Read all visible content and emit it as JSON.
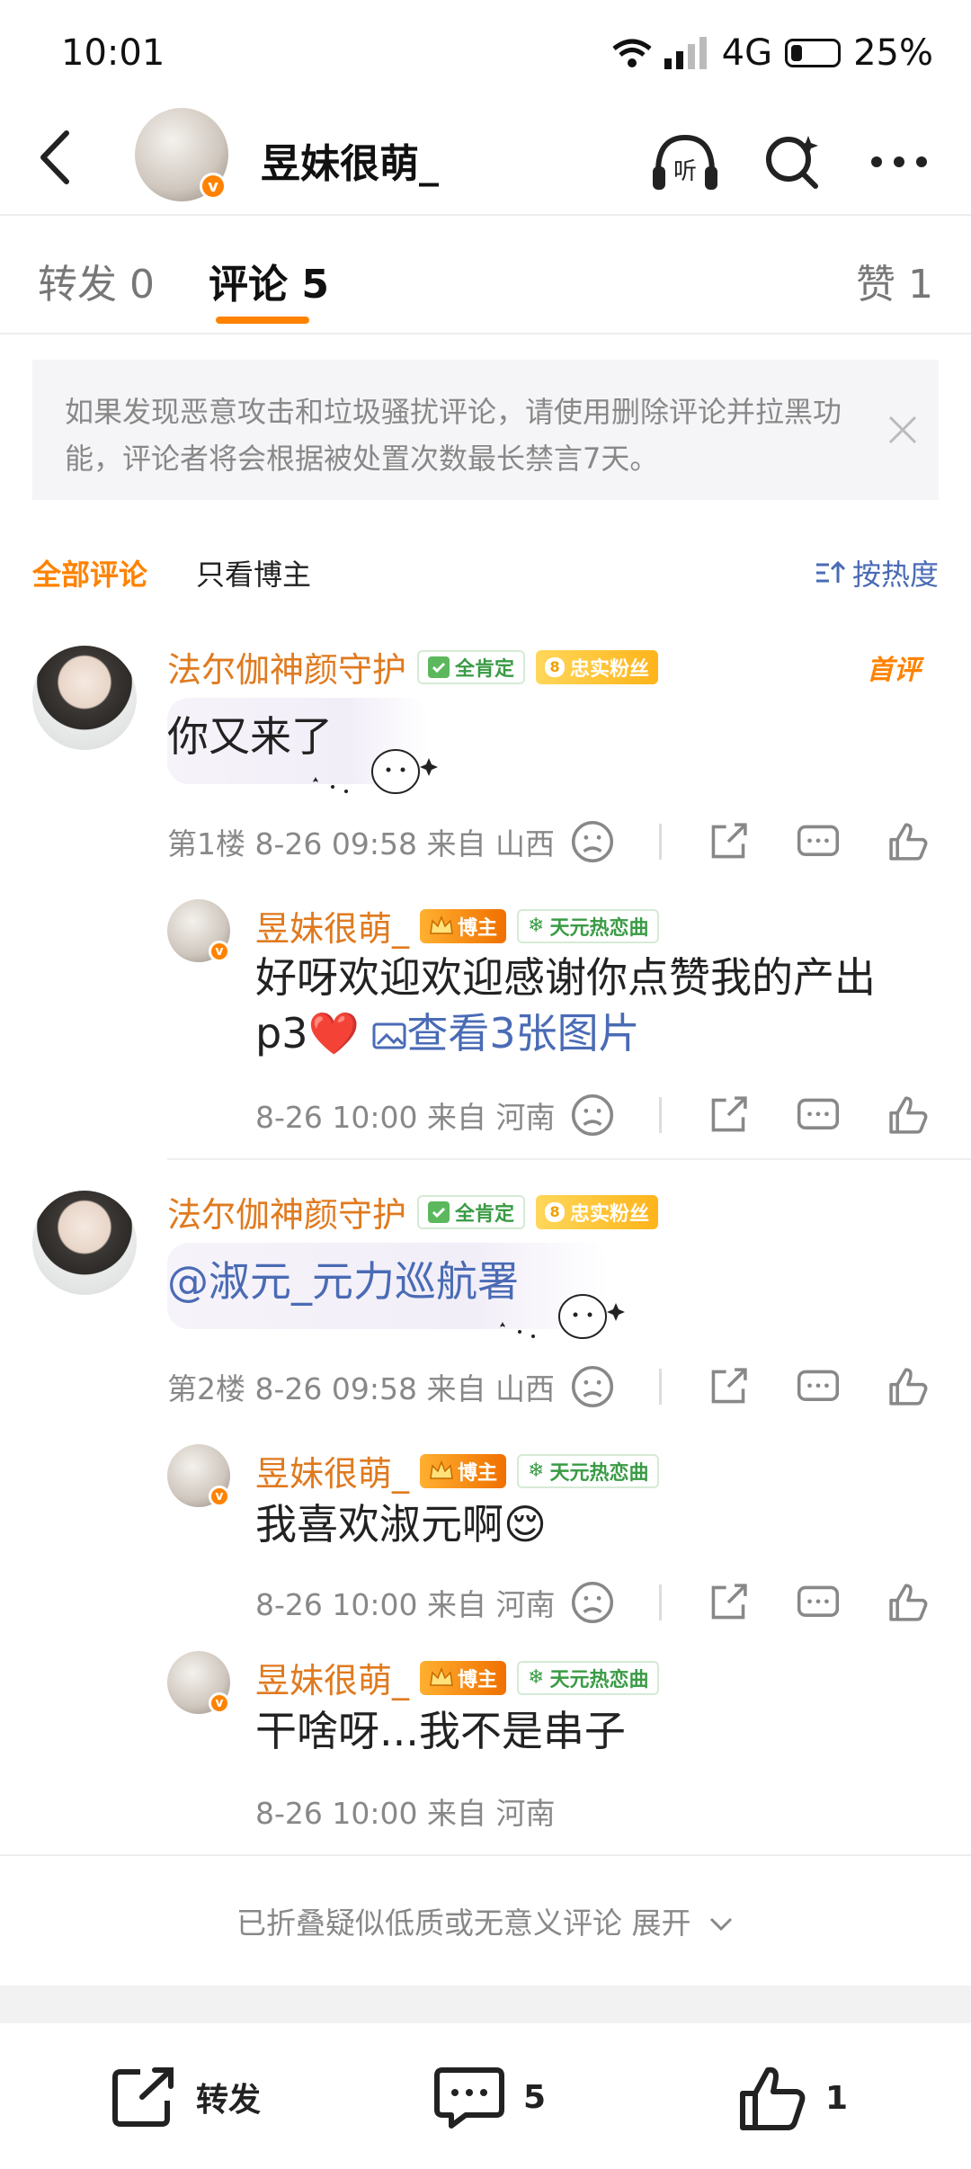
{
  "status": {
    "time": "10:01",
    "network": "4G",
    "battery": "25%",
    "battery_level": 0.25
  },
  "header": {
    "title": "昱妹很萌_",
    "verified_badge": "v"
  },
  "tabs": [
    {
      "label": "转发 0"
    },
    {
      "label": "评论 5"
    },
    {
      "label": "赞 1"
    }
  ],
  "notice": {
    "text": "如果发现恶意攻击和垃圾骚扰评论，请使用删除评论并拉黑功能，评论者将会根据被处置次数最长禁言7天。"
  },
  "filters": {
    "all": "全部评论",
    "blogger_only": "只看博主",
    "sort": "按热度"
  },
  "comments": [
    {
      "user": "法尔伽神颜守护",
      "badge1": "全肯定",
      "badge2": "忠实粉丝",
      "badge2_level": "8",
      "first_tag": "首评",
      "text": "你又来了",
      "floor": "第1楼",
      "time": "8-26 09:58",
      "location": "来自 山西",
      "reply": {
        "user": "昱妹很萌_",
        "badge1": "博主",
        "badge2": "天元热恋曲",
        "text": "好呀欢迎欢迎感谢你点赞我的产出p3❤️",
        "link": "查看3张图片",
        "time": "8-26 10:00",
        "location": "来自 河南"
      }
    },
    {
      "user": "法尔伽神颜守护",
      "badge1": "全肯定",
      "badge2": "忠实粉丝",
      "badge2_level": "8",
      "text": "@淑元_元力巡航署",
      "floor": "第2楼",
      "time": "8-26 09:58",
      "location": "来自 山西",
      "replies": [
        {
          "user": "昱妹很萌_",
          "badge1": "博主",
          "badge2": "天元热恋曲",
          "text": "我喜欢淑元啊😌",
          "time": "8-26 10:00",
          "location": "来自 河南"
        },
        {
          "user": "昱妹很萌_",
          "badge1": "博主",
          "badge2": "天元热恋曲",
          "text": "干啥呀...我不是串子",
          "time": "8-26 10:00",
          "location": "来自 河南"
        }
      ]
    }
  ],
  "folded": {
    "text": "已折叠疑似低质或无意义评论 展开"
  },
  "bottom": {
    "repost": "转发",
    "comment_count": "5",
    "like_count": "1"
  },
  "colors": {
    "accent": "#ff8200",
    "name_orange": "#e07a1f",
    "link_blue": "#4a6bb5"
  }
}
